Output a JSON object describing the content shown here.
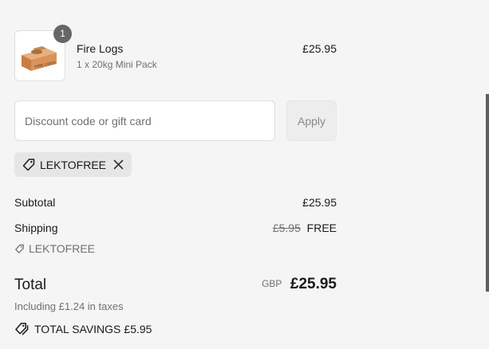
{
  "product": {
    "quantity": "1",
    "name": "Fire Logs",
    "variant": "1 x 20kg Mini Pack",
    "price": "£25.95",
    "image_label": "FIRE LOGS"
  },
  "discount": {
    "placeholder": "Discount code or gift card",
    "apply_label": "Apply",
    "applied_code": "LEKTOFREE"
  },
  "summary": {
    "subtotal_label": "Subtotal",
    "subtotal_value": "£25.95",
    "shipping_label": "Shipping",
    "shipping_original": "£5.95",
    "shipping_value": "FREE",
    "shipping_code": "LEKTOFREE",
    "total_label": "Total",
    "currency": "GBP",
    "total_value": "£25.95",
    "taxes_note": "Including £1.24 in taxes",
    "savings_label": "TOTAL SAVINGS",
    "savings_value": "£5.95"
  },
  "colors": {
    "background": "#f5f5f5",
    "badge": "#666666",
    "muted_text": "#707070",
    "chip_background": "#e6e6e6",
    "box_color": "#d9935a"
  },
  "icons": [
    "tag-icon",
    "close-icon",
    "discount-tag-icon",
    "savings-tag-icon"
  ]
}
